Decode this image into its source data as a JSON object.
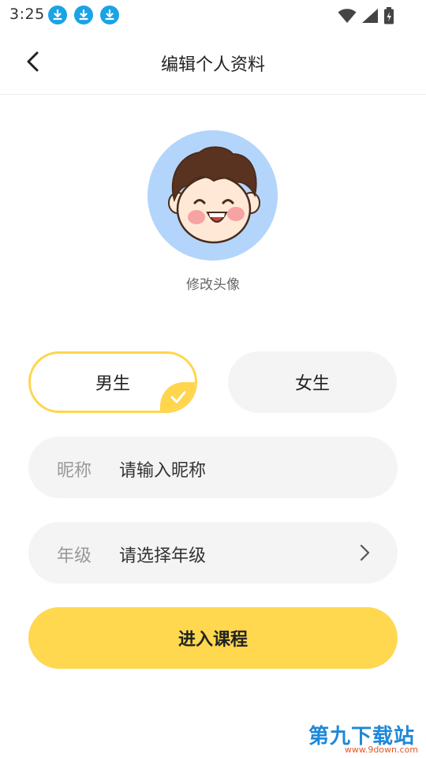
{
  "status_bar": {
    "time": "3:25",
    "notification_icons": [
      "download-icon",
      "download-icon",
      "download-icon"
    ],
    "right_icons": [
      "wifi-icon",
      "signal-icon",
      "battery-icon"
    ]
  },
  "header": {
    "title": "编辑个人资料",
    "back_icon": "chevron-left-icon"
  },
  "avatar": {
    "label": "修改头像",
    "background_color": "#b3d5fb"
  },
  "gender": {
    "male_label": "男生",
    "female_label": "女生",
    "selected": "male"
  },
  "nickname": {
    "label": "昵称",
    "placeholder": "请输入昵称"
  },
  "grade": {
    "label": "年级",
    "placeholder": "请选择年级"
  },
  "submit": {
    "label": "进入课程"
  },
  "colors": {
    "accent": "#ffd84f",
    "field_bg": "#f4f4f4"
  },
  "watermark": {
    "title": "第九下载站",
    "url": "www.9down.com"
  }
}
